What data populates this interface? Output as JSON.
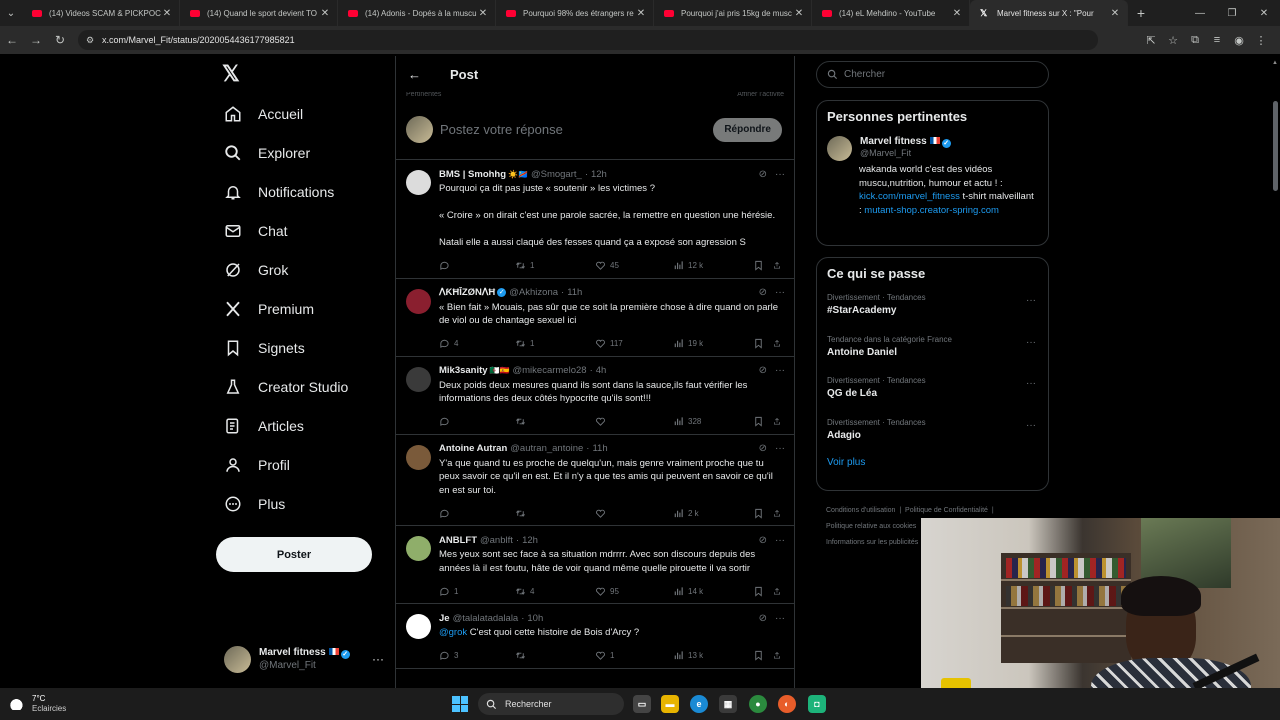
{
  "browser": {
    "tabs": [
      {
        "title": "(14) Videos SCAM & PICKPOCK",
        "type": "youtube"
      },
      {
        "title": "(14) Quand le sport devient TO",
        "type": "youtube"
      },
      {
        "title": "(14) Adonis - Dopés à la muscu",
        "type": "youtube"
      },
      {
        "title": "Pourquoi 98% des étrangers re",
        "type": "youtube"
      },
      {
        "title": "Pourquoi j'ai pris 15kg de musc",
        "type": "youtube"
      },
      {
        "title": "(14) eL Mehdino - YouTube",
        "type": "youtube"
      },
      {
        "title": "Marvel fitness sur X : \"Pour",
        "type": "x"
      }
    ],
    "url": "x.com/Marvel_Fit/status/2020054436177985821"
  },
  "sidebar": {
    "nav": [
      {
        "label": "Accueil",
        "icon": "home-icon"
      },
      {
        "label": "Explorer",
        "icon": "search-icon"
      },
      {
        "label": "Notifications",
        "icon": "bell-icon"
      },
      {
        "label": "Chat",
        "icon": "mail-icon"
      },
      {
        "label": "Grok",
        "icon": "grok-icon"
      },
      {
        "label": "Premium",
        "icon": "x-logo-icon"
      },
      {
        "label": "Signets",
        "icon": "bookmark-icon"
      },
      {
        "label": "Creator Studio",
        "icon": "flask-icon"
      },
      {
        "label": "Articles",
        "icon": "article-icon"
      },
      {
        "label": "Profil",
        "icon": "person-icon"
      },
      {
        "label": "Plus",
        "icon": "more-circle-icon"
      }
    ],
    "post_button": "Poster",
    "account": {
      "name": "Marvel fitness",
      "handle": "@Marvel_Fit"
    }
  },
  "center": {
    "title": "Post",
    "faded_left": "Pertinentes",
    "faded_right": "Affiner l'activité",
    "reply_placeholder": "Postez votre réponse",
    "reply_button": "Répondre",
    "tweets": [
      {
        "name": "BMS | Smohhg",
        "badges": "☀️🇨🇩",
        "handle": "@Smogart_",
        "time": "12h",
        "text": "Pourquoi ça dit pas juste « soutenir » les victimes ?\n\n« Croire » on dirait c'est une parole sacrée, la remettre en question une hérésie.\n\nNatali elle a aussi claqué des fesses quand ça a exposé son agression S",
        "replies": "",
        "reposts": "1",
        "likes": "45",
        "views": "12 k",
        "avatar_color": "#dcdcdc"
      },
      {
        "name": "ᐱƘĦĪZØNᐱĦ",
        "badges": "",
        "verified": true,
        "handle": "@Akhizona",
        "time": "11h",
        "text": "« Bien fait » Mouais, pas sûr que ce soit la première chose à dire quand on parle de viol ou de chantage sexuel ici",
        "replies": "4",
        "reposts": "1",
        "likes": "117",
        "views": "19 k",
        "avatar_color": "#8a1f2f"
      },
      {
        "name": "Mik3sanity",
        "badges": "🇩🇿🇪🇸",
        "handle": "@mikecarmelo28",
        "time": "4h",
        "text": "Deux poids deux mesures quand ils sont dans la sauce,ils faut vérifier les informations des deux côtés hypocrite qu'ils sont!!!",
        "replies": "",
        "reposts": "",
        "likes": "",
        "views": "328",
        "avatar_color": "#3a3a3a"
      },
      {
        "name": "Antoine Autran",
        "badges": "",
        "handle": "@autran_antoine",
        "time": "11h",
        "text": "Y'a que quand tu es proche de quelqu'un, mais genre vraiment proche que tu peux savoir ce qu'il en est. Et il n'y a que tes amis qui peuvent en savoir ce qu'il en est sur toi.",
        "replies": "",
        "reposts": "",
        "likes": "",
        "views": "2 k",
        "avatar_color": "#7a5a3a"
      },
      {
        "name": "ANBLFT",
        "badges": "",
        "handle": "@anblft",
        "time": "12h",
        "text": "Mes yeux sont sec face à sa situation mdrrrr. Avec son discours depuis des années là il est foutu, hâte de voir quand même quelle pirouette il va sortir",
        "replies": "1",
        "reposts": "4",
        "likes": "95",
        "views": "14 k",
        "avatar_color": "#8fae6a"
      },
      {
        "name": "Je",
        "badges": "",
        "handle": "@talalatadalala",
        "time": "10h",
        "mention": "@grok",
        "text": "C'est quoi cette histoire de Bois d'Arcy ?",
        "replies": "3",
        "reposts": "",
        "likes": "1",
        "views": "13 k",
        "avatar_color": "#ffffff"
      }
    ]
  },
  "right": {
    "search_placeholder": "Chercher",
    "relevant": {
      "title": "Personnes pertinentes",
      "name": "Marvel fitness",
      "handle": "@Marvel_Fit",
      "bio_text": "wakanda world c'est des vidéos muscu,nutrition, humour et actu ! :",
      "bio_link1": "kick.com/marvel_fitness",
      "bio_mid": " t-shirt malveillant : ",
      "bio_link2": "mutant-shop.creator-spring.com"
    },
    "happening": {
      "title": "Ce qui se passe",
      "trends": [
        {
          "category": "Divertissement · Tendances",
          "name": "#StarAcademy"
        },
        {
          "category": "Tendance dans la catégorie France",
          "name": "Antoine Daniel"
        },
        {
          "category": "Divertissement · Tendances",
          "name": "QG de Léa"
        },
        {
          "category": "Divertissement · Tendances",
          "name": "Adagio"
        }
      ],
      "see_more": "Voir plus"
    },
    "footer": {
      "l1a": "Conditions d'utilisation",
      "l1b": "Politique de Confidentialité",
      "l2": "Politique relative aux cookies",
      "l3": "Informations sur les publicités"
    }
  },
  "taskbar": {
    "temperature": "7°C",
    "condition": "Eclaircies",
    "search": "Rechercher"
  }
}
